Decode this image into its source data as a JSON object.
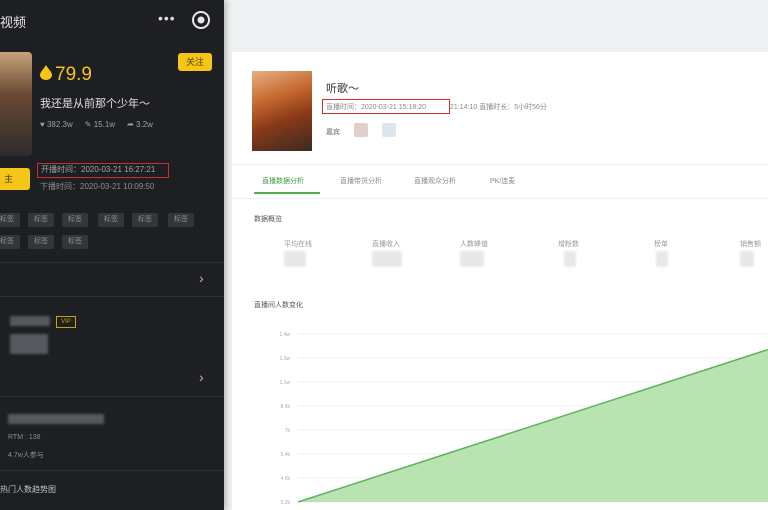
{
  "mobile": {
    "title": "视频",
    "dots": "•••",
    "score": "79.9",
    "follow_label": "关注",
    "song": "我还是从前那个少年～",
    "stats": [
      "382.3w",
      "15.1w",
      "3.2w"
    ],
    "yellow_btn": "主",
    "start_time": "开播时间：2020-03-21 16:27:21",
    "end_time": "下播时间：2020-03-21 10:09:50",
    "tags": [
      "标签",
      "标签",
      "标签",
      "标签",
      "标签",
      "标签",
      "标签",
      "标签",
      "标签"
    ],
    "vip": "VIP",
    "small1": "RTM : 138",
    "small2": "4.7w人参与",
    "bottom_label": "热门人数趋势图"
  },
  "web": {
    "name": "听歌～",
    "start_time": "直播时间：2020-03-21 15:18:20",
    "end_time": "21:14:10 直播时长：5小时56分",
    "guest_label": "嘉宾",
    "tabs": [
      "直播数据分析",
      "直播带货分析",
      "直播观众分析",
      "PK/连麦"
    ],
    "overview_title": "数据概览",
    "metrics": [
      "平均在线",
      "直播收入",
      "人数峰值",
      "增粉数",
      "榜单",
      "销售额"
    ],
    "chart_title": "直播间人数变化"
  },
  "chart_data": {
    "type": "area",
    "title": "直播间人数变化",
    "yticks": [
      "1.4w",
      "1.2w",
      "1.1w",
      "8.6k",
      "7k",
      "5.4k",
      "4.6k",
      "3.2k"
    ],
    "x": [
      0,
      1
    ],
    "values": [
      3200,
      13000
    ],
    "ylim": [
      3200,
      14000
    ],
    "fill_color": "#b9e3b0",
    "line_color": "#5bb35b",
    "grid": true
  }
}
